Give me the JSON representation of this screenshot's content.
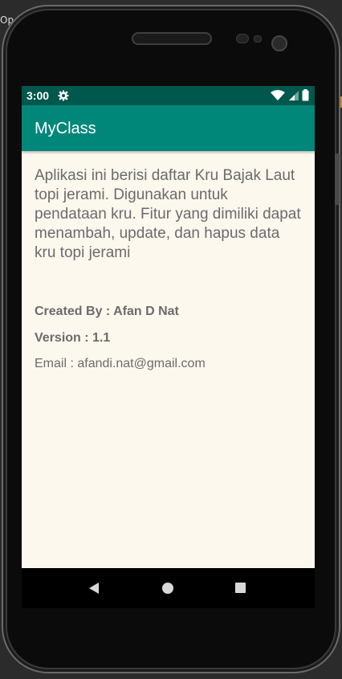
{
  "window": {
    "corner_label": "Op"
  },
  "status_bar": {
    "time": "3:00",
    "icons": [
      "gear-icon",
      "wifi-icon",
      "signal-icon",
      "battery-icon"
    ]
  },
  "app_bar": {
    "title": "MyClass",
    "color": "#00877a",
    "status_color": "#00574b"
  },
  "content": {
    "description": "Aplikasi ini berisi daftar Kru Bajak Laut topi jerami. Digunakan untuk pendataan kru. Fitur yang dimiliki dapat menambah, update, dan hapus data kru topi jerami",
    "created_by": "Created By : Afan D Nat",
    "version": "Version : 1.1",
    "email": "Email : afandi.nat@gmail.com",
    "background": "#fdf8ee"
  },
  "nav_bar": {
    "buttons": [
      "back-icon",
      "home-icon",
      "recents-icon"
    ]
  }
}
